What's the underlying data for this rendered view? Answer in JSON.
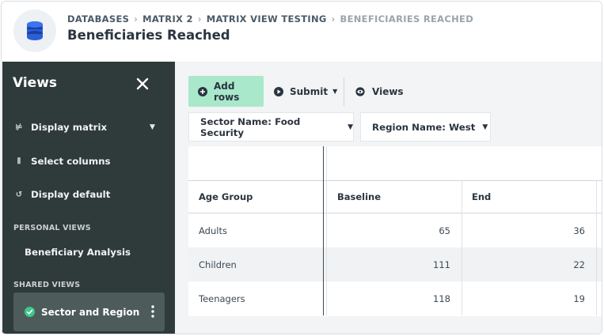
{
  "header": {
    "breadcrumb": [
      "DATABASES",
      "MATRIX 2",
      "MATRIX VIEW TESTING",
      "BENEFICIARIES REACHED"
    ],
    "separator": "›",
    "title": "Beneficiaries Reached",
    "icon": "database-icon"
  },
  "sidebar": {
    "title": "Views",
    "close_icon": "close-icon",
    "items": [
      {
        "icon": "matrix-icon",
        "glyph": "⊭",
        "label": "Display matrix"
      },
      {
        "icon": "columns-icon",
        "glyph": "⦀",
        "label": "Select columns"
      },
      {
        "icon": "reset-icon",
        "glyph": "↺",
        "label": "Display default"
      }
    ],
    "personal_label": "PERSONAL VIEWS",
    "personal_views": [
      "Beneficiary Analysis"
    ],
    "shared_label": "SHARED VIEWS",
    "shared_views": [
      "Sector and Region"
    ],
    "accent": "#3ec88c"
  },
  "toolbar": {
    "add_rows": "Add rows",
    "submit": "Submit",
    "views": "Views",
    "add_color": "#a9e8cb"
  },
  "filters": {
    "sector": "Sector Name: Food Security",
    "region": "Region Name: West"
  },
  "table": {
    "columns": [
      "Age Group",
      "Baseline",
      "End"
    ],
    "rows": [
      {
        "group": "Adults",
        "baseline": "65",
        "end": "36"
      },
      {
        "group": "Children",
        "baseline": "111",
        "end": "22"
      },
      {
        "group": "Teenagers",
        "baseline": "118",
        "end": "19"
      }
    ]
  }
}
